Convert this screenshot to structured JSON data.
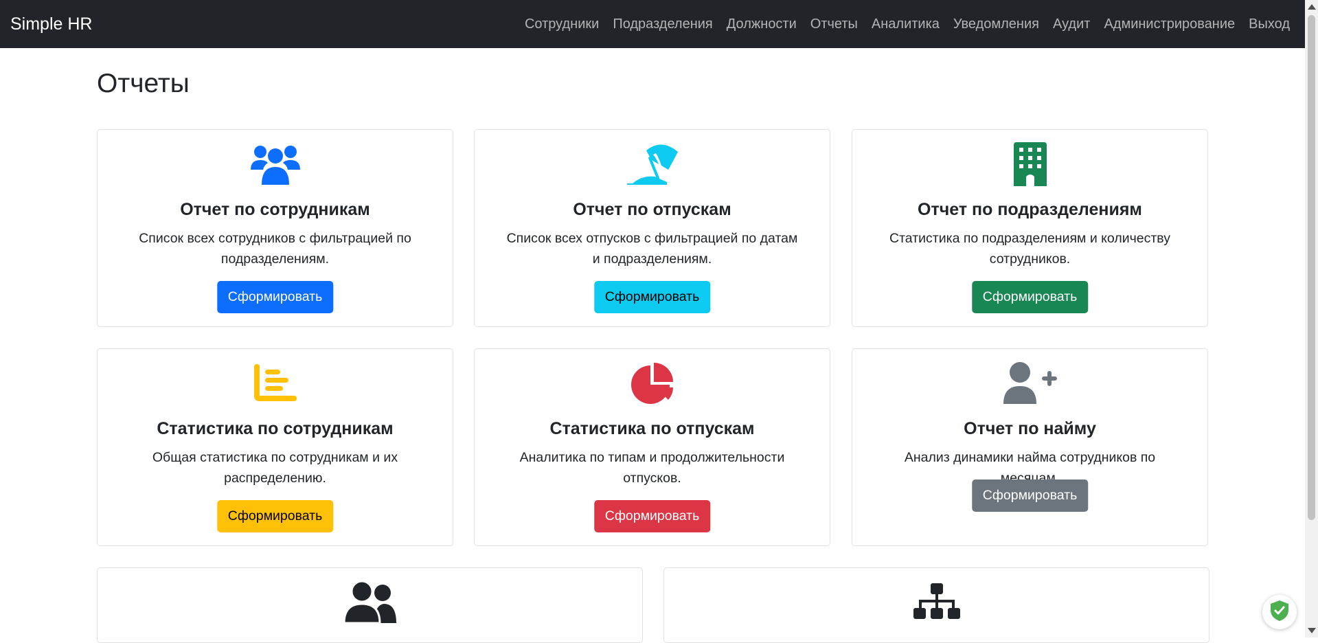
{
  "app": {
    "brand": "Simple HR"
  },
  "nav": {
    "items": [
      "Сотрудники",
      "Подразделения",
      "Должности",
      "Отчеты",
      "Аналитика",
      "Уведомления",
      "Аудит",
      "Администрирование",
      "Выход"
    ]
  },
  "page": {
    "title": "Отчеты"
  },
  "cards": [
    {
      "icon": "users-icon",
      "title": "Отчет по сотрудникам",
      "text": "Список всех сотрудников с фильтрацией по подразделениям.",
      "button": "Сформировать",
      "color": "#0d6efd"
    },
    {
      "icon": "umbrella-beach-icon",
      "title": "Отчет по отпускам",
      "text": "Список всех отпусков с фильтрацией по датам и подразделениям.",
      "button": "Сформировать",
      "color": "#0dcaf0"
    },
    {
      "icon": "building-icon",
      "title": "Отчет по подразделениям",
      "text": "Статистика по подразделениям и количеству сотрудников.",
      "button": "Сформировать",
      "color": "#198754"
    },
    {
      "icon": "bar-chart-icon",
      "title": "Статистика по сотрудникам",
      "text": "Общая статистика по сотрудникам и их распределению.",
      "button": "Сформировать",
      "color": "#ffc107"
    },
    {
      "icon": "pie-chart-icon",
      "title": "Статистика по отпускам",
      "text": "Аналитика по типам и продолжительности отпусков.",
      "button": "Сформировать",
      "color": "#dc3545"
    },
    {
      "icon": "user-plus-icon",
      "title": "Отчет по найму",
      "text": "Анализ динамики найма сотрудников по месяцам.",
      "button": "Сформировать",
      "color": "#6c757d"
    },
    {
      "icon": "user-group-icon",
      "color": "#212529"
    },
    {
      "icon": "sitemap-icon",
      "color": "#212529"
    }
  ]
}
